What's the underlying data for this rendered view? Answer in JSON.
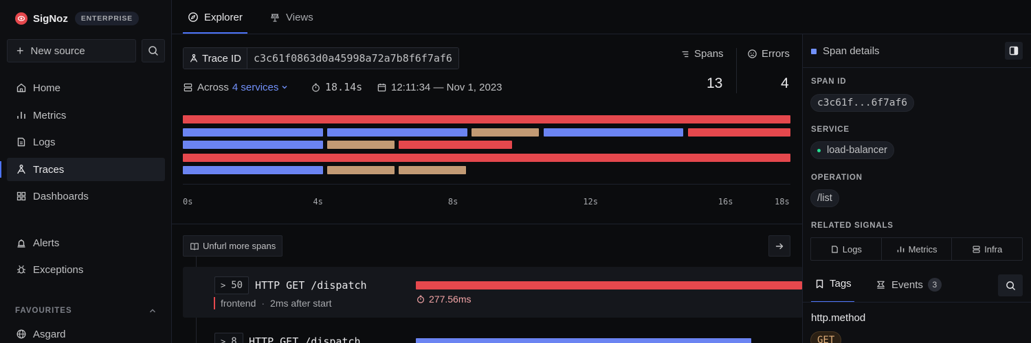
{
  "app": {
    "name": "SigNoz",
    "edition": "ENTERPRISE"
  },
  "sidebar": {
    "new_source": "New source",
    "nav": [
      {
        "label": "Home",
        "icon": "home-icon"
      },
      {
        "label": "Metrics",
        "icon": "bar-chart-icon"
      },
      {
        "label": "Logs",
        "icon": "logs-icon"
      },
      {
        "label": "Traces",
        "icon": "traces-icon",
        "active": true
      },
      {
        "label": "Dashboards",
        "icon": "grid-icon"
      },
      {
        "label": "Alerts",
        "icon": "bell-icon"
      },
      {
        "label": "Exceptions",
        "icon": "bug-icon"
      }
    ],
    "favourites_label": "FAVOURITES",
    "favourites": [
      {
        "label": "Asgard",
        "icon": "globe-icon"
      }
    ]
  },
  "tabs": [
    {
      "label": "Explorer",
      "icon": "compass-icon",
      "active": true
    },
    {
      "label": "Views",
      "icon": "views-icon"
    }
  ],
  "trace": {
    "id_label": "Trace ID",
    "id_value": "c3c61f0863d0a45998a72a7b8f6f7af6",
    "across_label": "Across",
    "services_link": "4 services",
    "duration": "18.14s",
    "timestamp": "12:11:34 — Nov 1, 2023",
    "spans_label": "Spans",
    "spans_value": "13",
    "errors_label": "Errors",
    "errors_value": "4"
  },
  "timeline": {
    "max": 18,
    "ticks": [
      "0s",
      "4s",
      "8s",
      "12s",
      "16s",
      "18s"
    ],
    "tick_values": [
      0,
      4,
      8,
      12,
      16,
      18
    ],
    "colors": {
      "red": "#e5484d",
      "blue": "#6b84f2",
      "tan": "#c29a74"
    },
    "rows": [
      [
        {
          "start": 0,
          "end": 18,
          "color": "red"
        }
      ],
      [
        {
          "start": 0,
          "end": 4.15,
          "color": "blue"
        },
        {
          "start": 4.28,
          "end": 8.43,
          "color": "blue"
        },
        {
          "start": 8.56,
          "end": 10.55,
          "color": "tan"
        },
        {
          "start": 10.68,
          "end": 14.83,
          "color": "blue"
        },
        {
          "start": 14.96,
          "end": 18,
          "color": "red"
        }
      ],
      [
        {
          "start": 0,
          "end": 4.15,
          "color": "blue"
        },
        {
          "start": 4.28,
          "end": 6.27,
          "color": "tan"
        },
        {
          "start": 6.4,
          "end": 9.76,
          "color": "red"
        }
      ],
      [
        {
          "start": 0,
          "end": 18,
          "color": "red"
        }
      ],
      [
        {
          "start": 0,
          "end": 4.15,
          "color": "blue"
        },
        {
          "start": 4.28,
          "end": 6.27,
          "color": "tan"
        },
        {
          "start": 6.4,
          "end": 8.39,
          "color": "tan"
        }
      ]
    ]
  },
  "spans_list": {
    "unfurl_label": "Unfurl more spans",
    "items": [
      {
        "count": "50",
        "name": "HTTP GET /dispatch",
        "service": "frontend",
        "offset": "2ms after start",
        "duration": "277.56ms"
      },
      {
        "count": "8",
        "name": "HTTP GET /dispatch"
      }
    ]
  },
  "details": {
    "title": "Span details",
    "span_id_label": "SPAN ID",
    "span_id": "c3c61f...6f7af6",
    "service_label": "SERVICE",
    "service": "load-balancer",
    "operation_label": "OPERATION",
    "operation": "/list",
    "related_label": "RELATED SIGNALS",
    "signals": [
      "Logs",
      "Metrics",
      "Infra"
    ],
    "tabs": {
      "tags": "Tags",
      "events": "Events",
      "events_count": "3"
    },
    "tag_key": "http.method",
    "tag_value": "GET"
  }
}
